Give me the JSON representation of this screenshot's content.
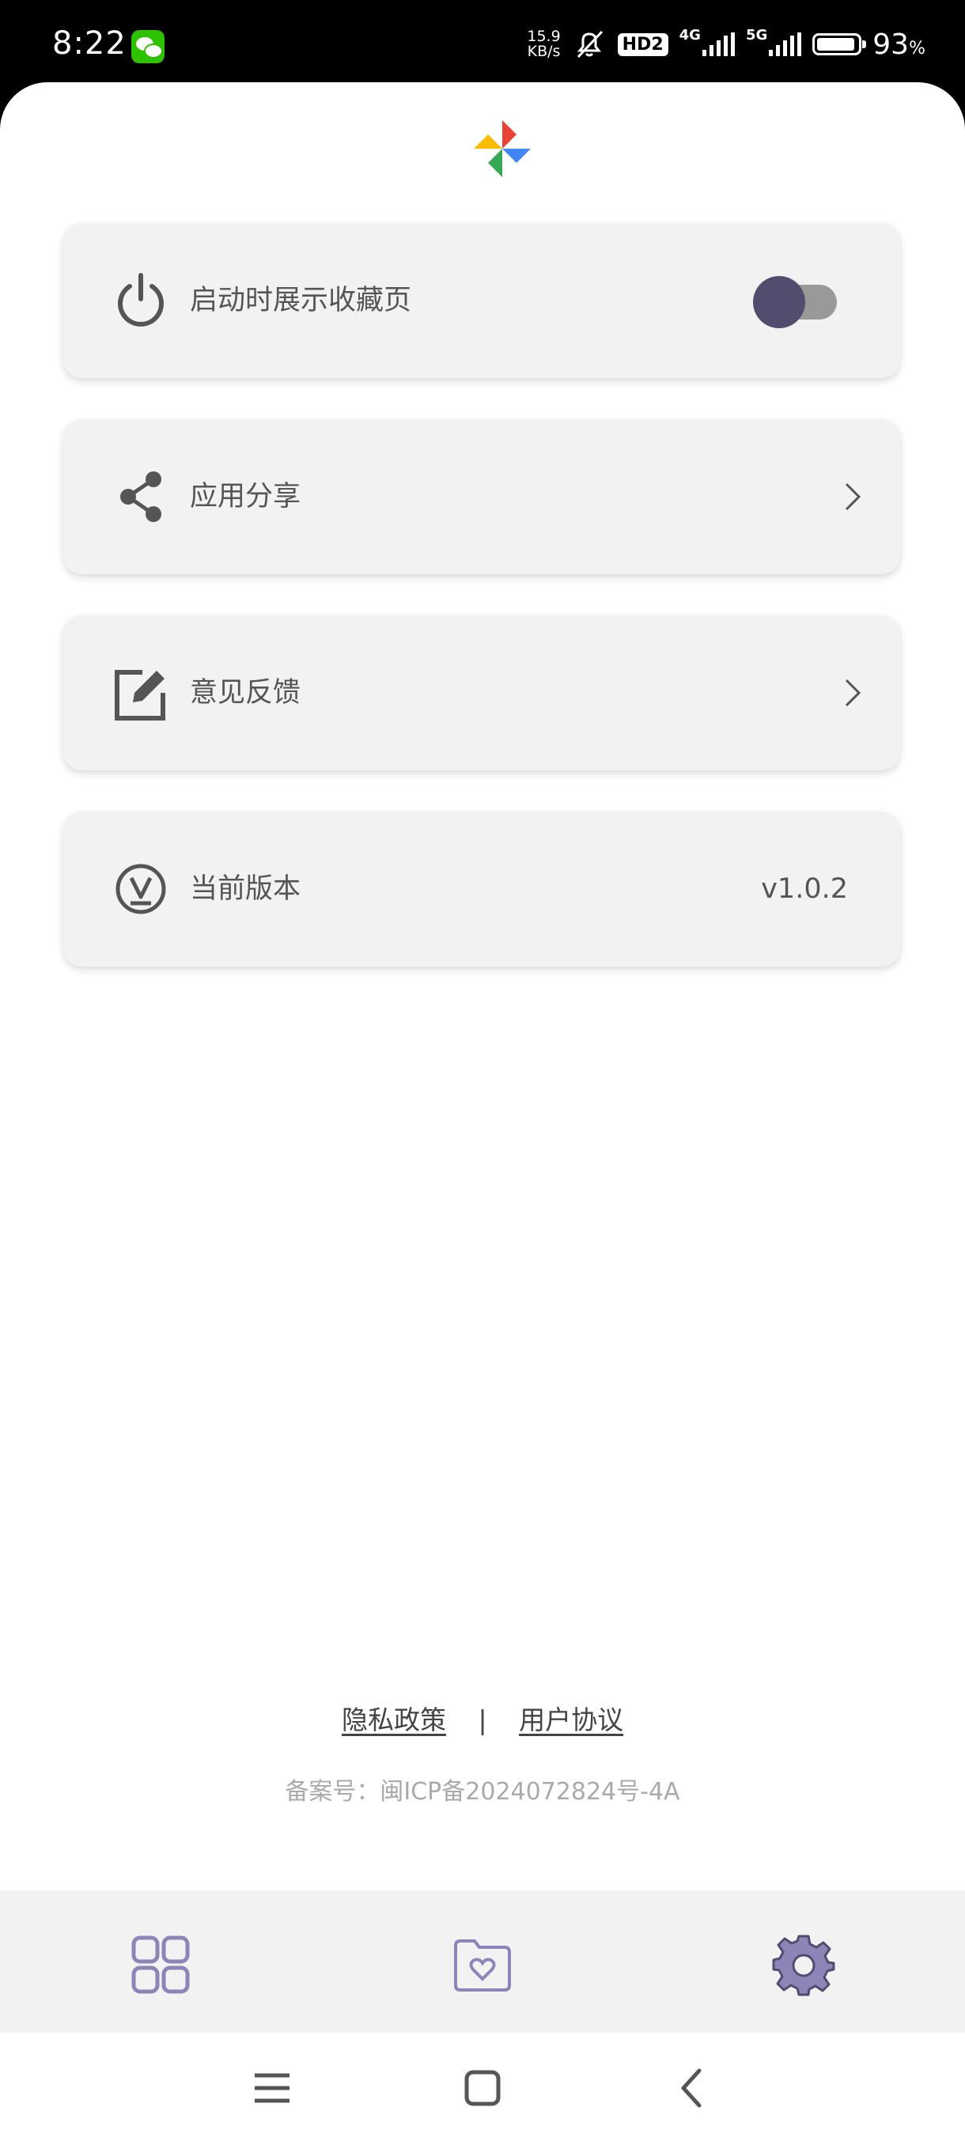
{
  "status_bar": {
    "time": "8:22",
    "speed_value": "15.9",
    "speed_unit": "KB/s",
    "hd_badge": "HD2",
    "network1": "4G",
    "network2": "5G",
    "battery_percent": "93",
    "battery_sign": "%"
  },
  "settings": {
    "startup_favorites": {
      "label": "启动时展示收藏页",
      "toggle_on": false
    },
    "share": {
      "label": "应用分享"
    },
    "feedback": {
      "label": "意见反馈"
    },
    "version": {
      "label": "当前版本",
      "value": "v1.0.2"
    }
  },
  "footer": {
    "privacy_link": "隐私政策",
    "separator": "|",
    "agreement_link": "用户协议",
    "icp": "备案号：闽ICP备2024072824号-4A"
  },
  "tabs": [
    {
      "icon": "grid-icon",
      "active": false
    },
    {
      "icon": "favorite-folder-icon",
      "active": false
    },
    {
      "icon": "gear-icon",
      "active": true
    }
  ],
  "colors": {
    "accent": "#8c86b8",
    "toggle_knob": "#524d6f",
    "card_bg": "#f2f2f2"
  }
}
